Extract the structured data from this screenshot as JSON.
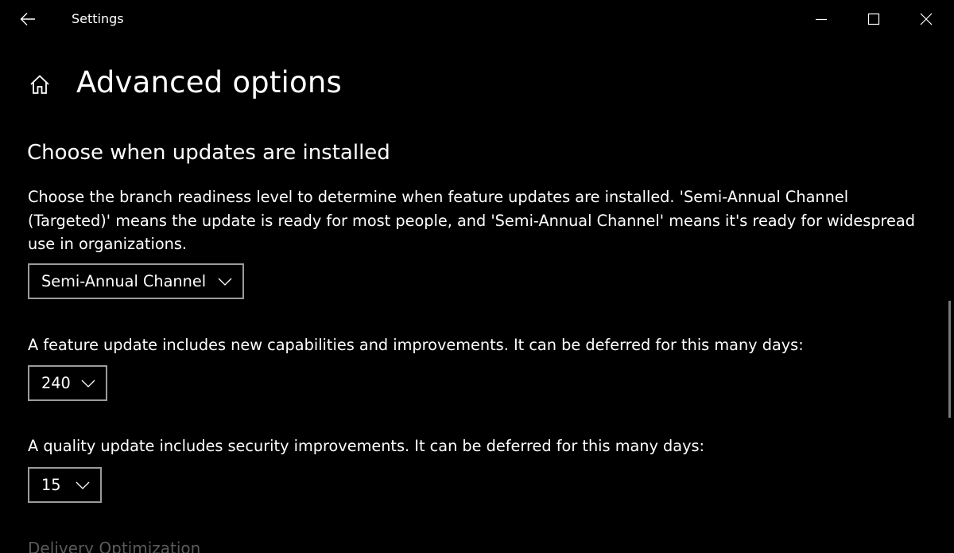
{
  "window": {
    "app_title": "Settings"
  },
  "header": {
    "title": "Advanced options"
  },
  "section": {
    "heading": "Choose when updates are installed",
    "description": "Choose the branch readiness level to determine when feature updates are installed. 'Semi-Annual Channel (Targeted)' means the update is ready for most people, and 'Semi-Annual Channel' means it's ready for widespread use in organizations.",
    "branch_dropdown": {
      "selected": "Semi-Annual Channel"
    },
    "feature_update": {
      "label": "A feature update includes new capabilities and improvements. It can be deferred for this many days:",
      "selected": "240"
    },
    "quality_update": {
      "label": "A quality update includes security improvements. It can be deferred for this many days:",
      "selected": "15"
    }
  },
  "next_section": {
    "heading": "Delivery Optimization"
  },
  "icons": {
    "back": "back-arrow-icon",
    "home": "home-icon",
    "minimize": "minimize-icon",
    "maximize": "maximize-icon",
    "close": "close-icon",
    "chevron": "chevron-down-icon"
  },
  "colors": {
    "background": "#000000",
    "text": "#ffffff",
    "dropdown_border": "#9b9b9b",
    "faded_text": "#5a5a5a"
  }
}
